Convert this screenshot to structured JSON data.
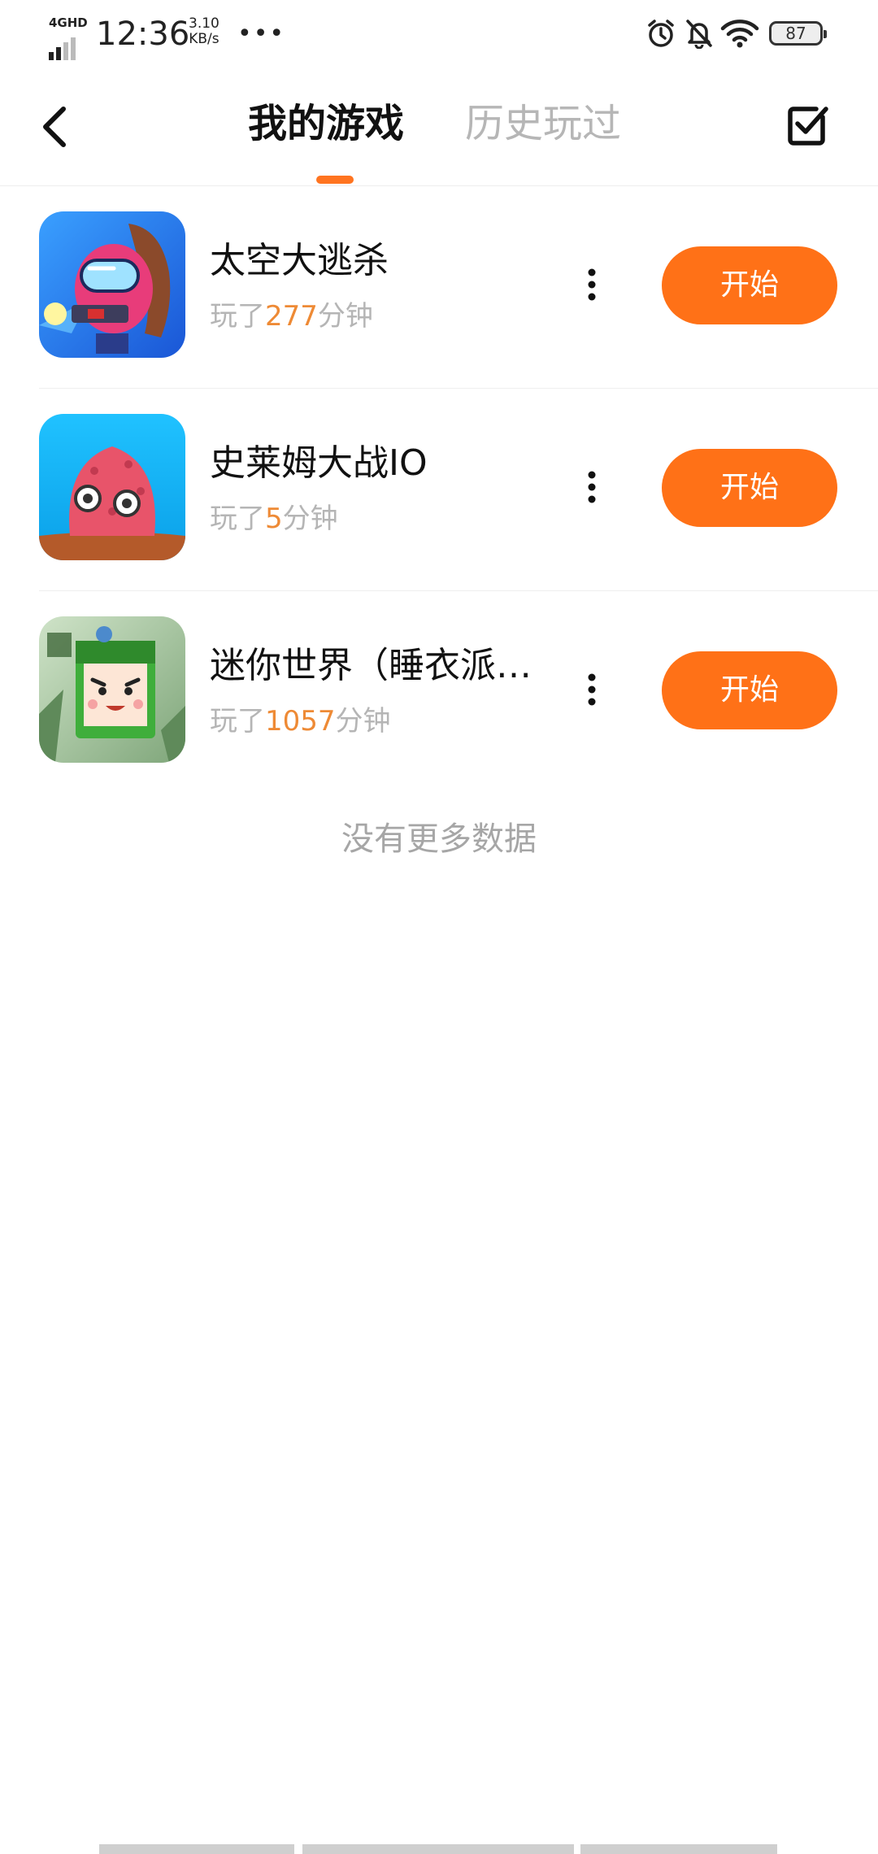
{
  "status_bar": {
    "network": "4GHD",
    "time": "12:36",
    "speed_value": "3.10",
    "speed_unit": "KB/s",
    "overflow": "•••",
    "battery": "87"
  },
  "header": {
    "tabs": [
      {
        "label": "我的游戏",
        "active": true
      },
      {
        "label": "历史玩过",
        "active": false
      }
    ],
    "accent_color": "#ff7420"
  },
  "games": [
    {
      "name": "太空大逃杀",
      "played_prefix": "玩了",
      "minutes": "277",
      "played_suffix": "分钟",
      "start_label": "开始",
      "icon": "space-escape-icon"
    },
    {
      "name": "史莱姆大战IO",
      "played_prefix": "玩了",
      "minutes": "5",
      "played_suffix": "分钟",
      "start_label": "开始",
      "icon": "slime-io-icon"
    },
    {
      "name": "迷你世界（睡衣派…",
      "played_prefix": "玩了",
      "minutes": "1057",
      "played_suffix": "分钟",
      "start_label": "开始",
      "icon": "mini-world-icon"
    }
  ],
  "footer": {
    "no_more": "没有更多数据"
  },
  "colors": {
    "start_button": "#ff7117",
    "minutes_highlight": "#ee8a35"
  }
}
